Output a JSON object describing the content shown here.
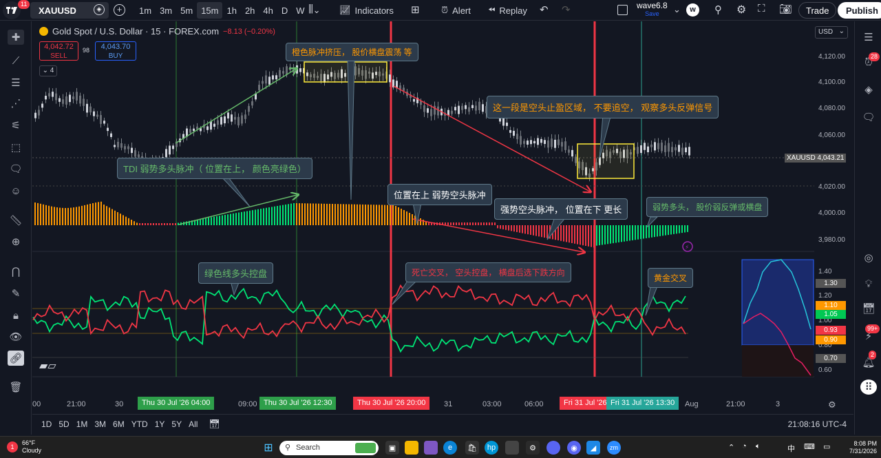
{
  "topbar": {
    "logo_badge": "11",
    "symbol": "XAUUSD",
    "intervals": [
      "1m",
      "3m",
      "5m",
      "15m",
      "1h",
      "2h",
      "4h",
      "D",
      "W"
    ],
    "active_interval": "15m",
    "indicators_label": "Indicators",
    "alert_label": "Alert",
    "replay_label": "Replay",
    "layout_name": "wave6.8",
    "layout_sub": "Save",
    "avatar_letter": "w",
    "trade_label": "Trade",
    "publish_label": "Publish"
  },
  "legend": {
    "title": "Gold Spot / U.S. Dollar · 15 · FOREX.com",
    "change": "−8.13 (−0.20%)",
    "sell_price": "4,042.72",
    "sell_label": "SELL",
    "spread": "98",
    "buy_price": "4,043.70",
    "buy_label": "BUY",
    "collapse_count": "4"
  },
  "annotations": {
    "a1": "橙色脉冲挤压，  股价横盘震荡  等",
    "a2": "这一段是空头止盈区域，  不要追空，  观察多头反弹信号",
    "a3": "TDI 弱势多头脉冲（ 位置在上，  颜色亮绿色）",
    "a4": "位置在上  弱势空头脉冲",
    "a5": "强势空头脉冲，  位置在下  更长",
    "a6": "弱势多头，  股价弱反弹或横盘",
    "a7": "绿色线多头控盘",
    "a8": "死亡交叉，  空头控盘，  横盘后选下跌方向",
    "a9": "黄金交叉"
  },
  "price_axis": {
    "currency": "USD",
    "labels": [
      "4,120.00",
      "4,100.00",
      "4,080.00",
      "4,060.00",
      "4,020.00",
      "4,000.00",
      "3,980.00"
    ],
    "symbol_tag": "XAUUSD",
    "price_tag": "4,043.21",
    "osc_labels": [
      "1.40",
      "1.20",
      "1.00",
      "0.80",
      "0.60"
    ],
    "osc_tags": [
      "1.30",
      "1.10",
      "1.05",
      "0.93",
      "0.90",
      "0.70"
    ],
    "colors": {
      "up": "#26a69a",
      "down": "#f23645",
      "green": "#00e676",
      "orange": "#ff9800",
      "red": "#f23645"
    }
  },
  "time_axis": {
    "labels": [
      "00",
      "21:00",
      "30",
      "09:00",
      "31",
      "03:00",
      "06:00",
      "Aug",
      "21:00",
      "3"
    ],
    "tags": [
      "Thu 30 Jul '26   04:00",
      "Thu 30 Jul '26   12:30",
      "Thu 30 Jul '26   20:00",
      "Fri 31 Jul '26",
      "Fri 31 Jul '26   13:30"
    ]
  },
  "bottombar": {
    "ranges": [
      "1D",
      "5D",
      "1M",
      "3M",
      "6M",
      "YTD",
      "1Y",
      "5Y",
      "All"
    ],
    "clock": "21:08:16 UTC-4"
  },
  "right_badges": {
    "alerts": "28",
    "notif": "99+",
    "msgs": "2"
  },
  "taskbar": {
    "weather_temp": "66°F",
    "weather_desc": "Cloudy",
    "search_placeholder": "Search",
    "lang": "中",
    "time": "8:08 PM",
    "date": "7/31/2026"
  }
}
